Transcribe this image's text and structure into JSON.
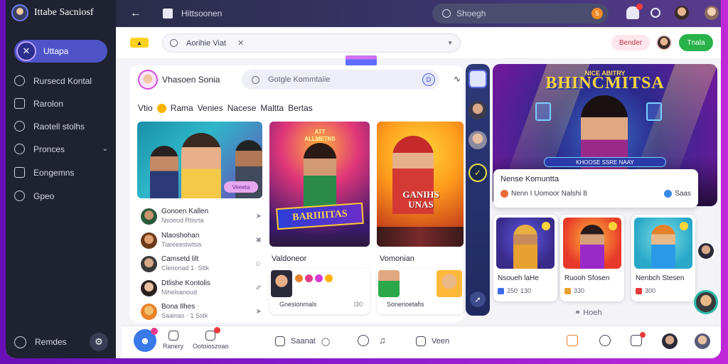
{
  "app": {
    "title": "Ittabe Sacniosf"
  },
  "sidebar": {
    "home_label": "Uttapa",
    "items": [
      {
        "label": "Rursecd Kontal",
        "icon": "chat-icon"
      },
      {
        "label": "Rarolon",
        "icon": "document-icon"
      },
      {
        "label": "Raotell stolhs",
        "icon": "chat-bubble-icon"
      },
      {
        "label": "Pronces",
        "icon": "shield-icon"
      },
      {
        "label": "Eongemns",
        "icon": "list-icon"
      },
      {
        "label": "Gpeo",
        "icon": "refresh-icon"
      }
    ],
    "bottom_label": "Remdes"
  },
  "topbar": {
    "title": "Hittsoonen",
    "search_placeholder": "Shoegh",
    "search_badge": "5"
  },
  "toolbar": {
    "search_value": "Aorihie Viat",
    "pink_button": "Bender",
    "green_button": "Tnala"
  },
  "left_card": {
    "name": "Vhasoen Sonia",
    "search_placeholder": "Gotgle Kommtaiie",
    "chips": [
      "Vtio",
      "Rama",
      "Venies",
      "Nacese",
      "Maltta",
      "Bertas"
    ],
    "tile1_tag": "Veeeta",
    "tile2_header": "ATT ALLMETNS",
    "tile2_banner": "BARIIIITAS",
    "tile3_title": "GANIHS UNAS",
    "list": [
      {
        "name": "Gonoen Kallen",
        "sub": "Nsoeod Rtisrta",
        "action": "➤"
      },
      {
        "name": "Nlaoshohan",
        "sub": "Tiareeeslwtsis",
        "action": "✖"
      },
      {
        "name": "Camsetd lilt",
        "sub": "Cleoonad 1· Sttk",
        "action": "☺"
      },
      {
        "name": "Dtlishe Kontolis",
        "sub": "Nihelsanoud",
        "action": "✐"
      },
      {
        "name": "Bona Ilhes",
        "sub": "Saainas · 1 Sstk",
        "action": "➤"
      }
    ],
    "sub1": "Valdoneor",
    "sub2": "Vomonian",
    "mini1_caption": "Gnesionmals",
    "mini1_time": "l30",
    "mini2_caption": "Sonerioetafis"
  },
  "hero": {
    "small_title": "NICE ABITRY",
    "title": "BHINCMITSA",
    "ribbon": "KHOOSE SSRE NAAY",
    "card_title": "Nense Komuntta",
    "card_meta": "Nenn I Uomoor Nalshi 8",
    "card_right": "Saas"
  },
  "game_cards": [
    {
      "title": "Nsoueh laHe",
      "stat": "130",
      "stat_prefix": "250"
    },
    {
      "title": "Ruooh Sfosen",
      "stat": "330",
      "stat_prefix": ""
    },
    {
      "title": "Nenbch Stesen",
      "stat": "300",
      "stat_prefix": ""
    }
  ],
  "more_label": "Hoeh",
  "bottombar": {
    "item1": "Ranery",
    "item2": "Ootoioszoao",
    "inline1": "Saanat",
    "inline2": "Veen"
  },
  "colors": {
    "accent": "#4e54c8",
    "green": "#27b24a",
    "sidebar": "#1f2230"
  }
}
